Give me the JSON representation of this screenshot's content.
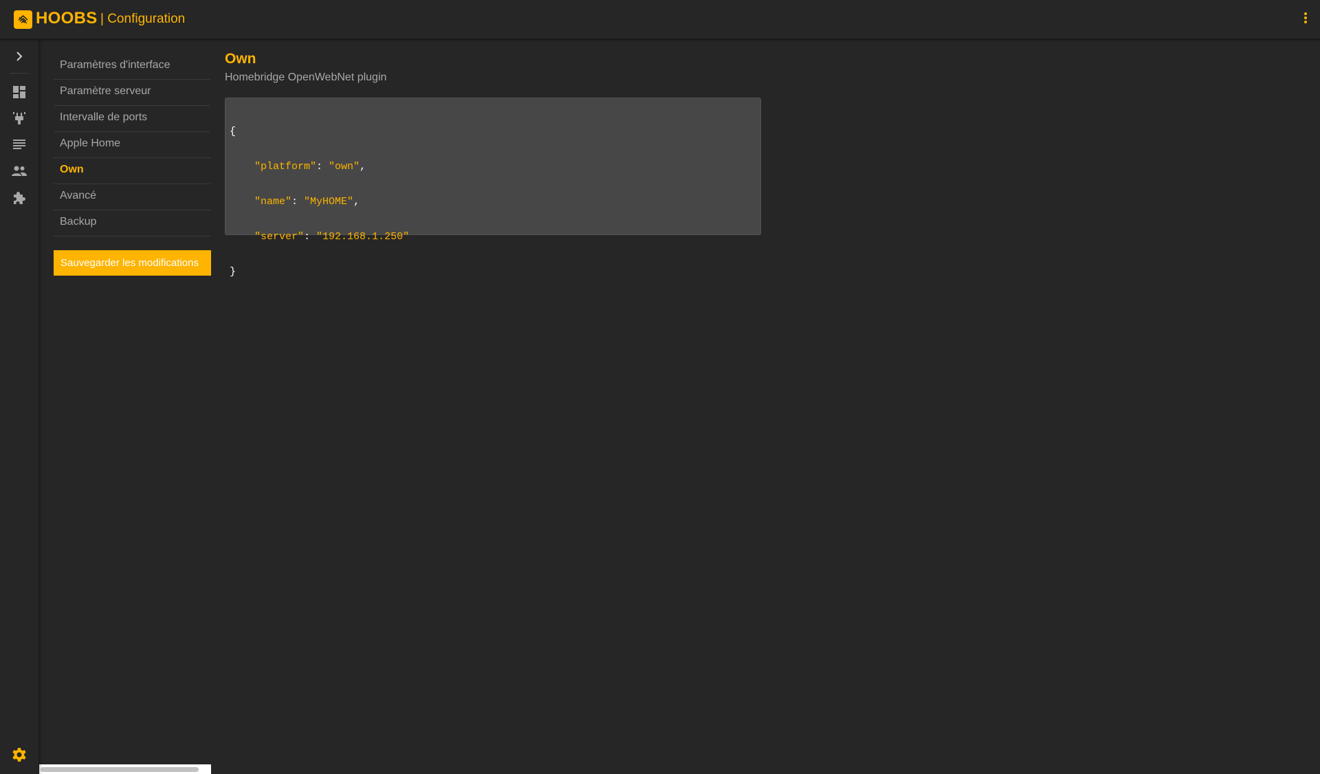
{
  "header": {
    "brand": "HOOBS",
    "section": "| Configuration",
    "icons": {
      "logo": "hoobs-logo-icon",
      "menu": "more-vert-icon"
    },
    "accent_color": "#feb400"
  },
  "rail": {
    "icons": [
      "chevron-right-icon",
      "dashboard-icon",
      "plug-icon",
      "log-icon",
      "users-icon",
      "puzzle-icon",
      "gear-icon"
    ]
  },
  "subnav": {
    "items": [
      {
        "label": "Paramètres d'interface"
      },
      {
        "label": "Paramètre serveur"
      },
      {
        "label": "Intervalle de ports"
      },
      {
        "label": "Apple Home"
      },
      {
        "label": "Own",
        "active": true
      },
      {
        "label": "Avancé"
      },
      {
        "label": "Backup"
      }
    ],
    "save_label": "Sauvegarder les modifications"
  },
  "main": {
    "title": "Own",
    "subtitle": "Homebridge OpenWebNet plugin",
    "config": {
      "open_brace": "{",
      "close_brace": "}",
      "entries": [
        {
          "key": "\"platform\"",
          "value": "\"own\"",
          "trail": ","
        },
        {
          "key": "\"name\"",
          "value": "\"MyHOME\"",
          "trail": ","
        },
        {
          "key": "\"server\"",
          "value": "\"192.168.1.250\"",
          "trail": ""
        }
      ]
    }
  }
}
